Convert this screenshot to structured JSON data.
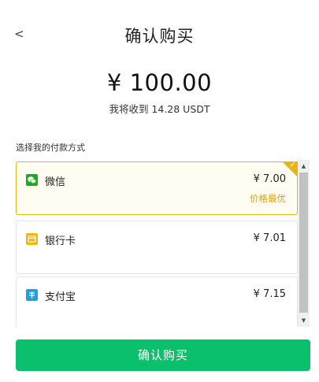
{
  "header": {
    "back_icon": "chevron-left-icon",
    "back_glyph": "<",
    "title": "确认购买"
  },
  "amount": "¥ 100.00",
  "receive_text": "我将收到 14.28 USDT",
  "section_label": "选择我的付款方式",
  "payment_methods": [
    {
      "name": "微信",
      "price": "¥ 7.00",
      "tag": "价格最优",
      "icon": "wechat-icon",
      "icon_color": "#1aad19",
      "selected": true
    },
    {
      "name": "银行卡",
      "price": "¥ 7.01",
      "tag": "",
      "icon": "bank-card-icon",
      "icon_color": "#f0b90b",
      "selected": false
    },
    {
      "name": "支付宝",
      "price": "¥ 7.15",
      "tag": "",
      "icon": "alipay-icon",
      "icon_color": "#1aa1e8",
      "selected": false
    }
  ],
  "confirm_label": "确认购买",
  "colors": {
    "accent_green": "#0bc06c",
    "highlight_gold": "#e9b415",
    "best_price_text": "#e0a10d"
  }
}
